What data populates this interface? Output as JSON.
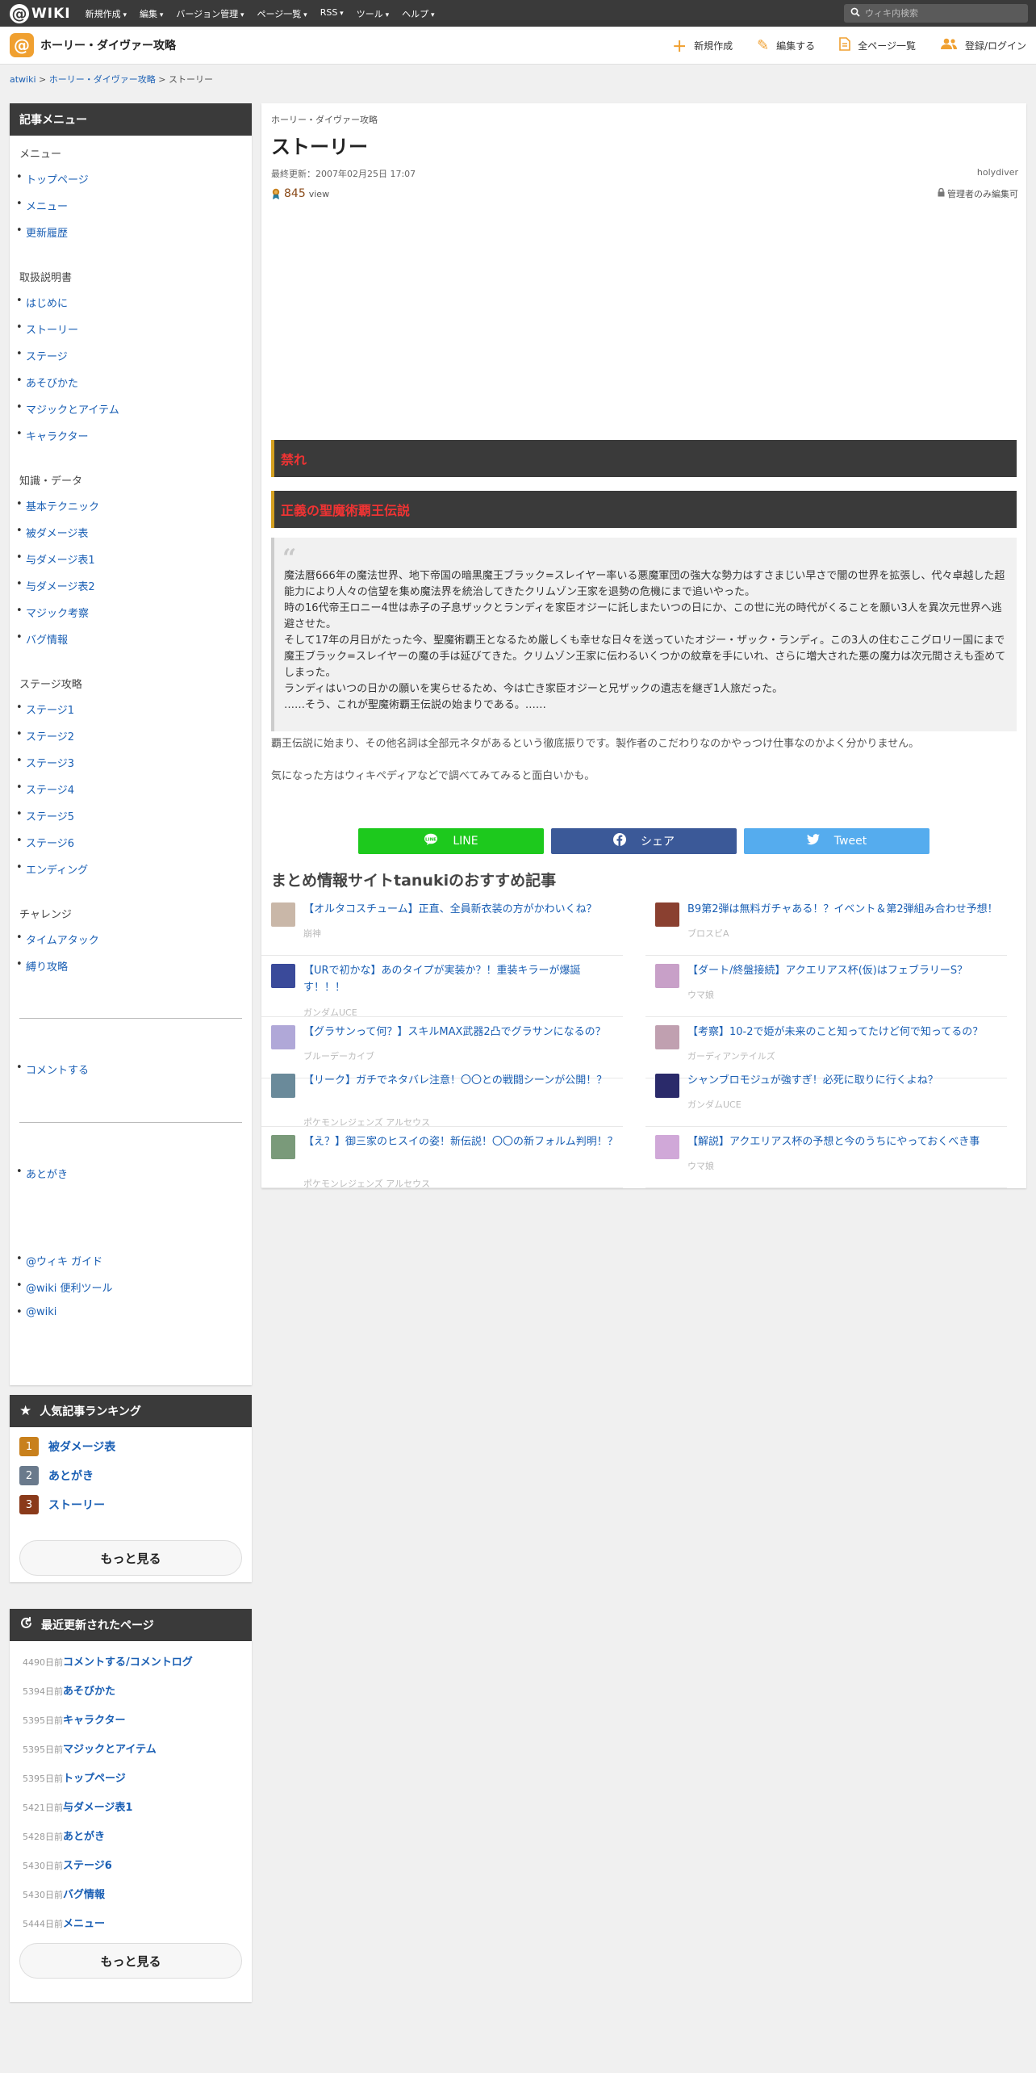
{
  "topbar": {
    "logo_mark": "@",
    "logo_text": "WIKI",
    "menus": [
      "新規作成",
      "編集",
      "バージョン管理",
      "ページ一覧",
      "RSS",
      "ツール",
      "ヘルプ"
    ],
    "search_placeholder": "ウィキ内検索"
  },
  "header": {
    "wiki_title": "ホーリー・ダイヴァー攻略",
    "actions": [
      "新規作成",
      "編集する",
      "全ページ一覧",
      "登録/ログイン"
    ]
  },
  "breadcrumb": {
    "root": "atwiki",
    "sep": ">",
    "wiki": "ホーリー・ダイヴァー攻略",
    "current": "ストーリー"
  },
  "sidebar": {
    "menu_title": "記事メニュー",
    "sections": [
      {
        "title": "メニュー",
        "items": [
          "トップページ",
          "メニュー",
          "更新履歴"
        ]
      },
      {
        "title": "取扱説明書",
        "items": [
          "はじめに",
          "ストーリー",
          "ステージ",
          "あそびかた",
          "マジックとアイテム",
          "キャラクター"
        ]
      },
      {
        "title": "知識・データ",
        "items": [
          "基本テクニック",
          "被ダメージ表",
          "与ダメージ表1",
          "与ダメージ表2",
          "マジック考察",
          "バグ情報"
        ]
      },
      {
        "title": "ステージ攻略",
        "items": [
          "ステージ1",
          "ステージ2",
          "ステージ3",
          "ステージ4",
          "ステージ5",
          "ステージ6",
          "エンディング"
        ]
      },
      {
        "title": "チャレンジ",
        "items": [
          "タイムアタック",
          "縛り攻略"
        ]
      }
    ],
    "comment_link": "コメントする",
    "afterword_link": "あとがき",
    "footer_links": [
      "@ウィキ ガイド",
      "@wiki 便利ツール",
      "@wiki"
    ]
  },
  "ranking": {
    "title": "人気記事ランキング",
    "items": [
      {
        "rank": "1",
        "label": "被ダメージ表"
      },
      {
        "rank": "2",
        "label": "あとがき"
      },
      {
        "rank": "3",
        "label": "ストーリー"
      }
    ],
    "more": "もっと見る",
    "colors": [
      "#c8801c",
      "#6a7a8c",
      "#8a3a1a"
    ]
  },
  "recent": {
    "title": "最近更新されたページ",
    "items": [
      {
        "days": "4490日前",
        "title": "コメントする/コメントログ"
      },
      {
        "days": "5394日前",
        "title": "あそびかた"
      },
      {
        "days": "5395日前",
        "title": "キャラクター"
      },
      {
        "days": "5395日前",
        "title": "マジックとアイテム"
      },
      {
        "days": "5395日前",
        "title": "トップページ"
      },
      {
        "days": "5421日前",
        "title": "与ダメージ表1"
      },
      {
        "days": "5428日前",
        "title": "あとがき"
      },
      {
        "days": "5430日前",
        "title": "ステージ6"
      },
      {
        "days": "5430日前",
        "title": "バグ情報"
      },
      {
        "days": "5444日前",
        "title": "メニュー"
      }
    ],
    "more": "もっと見る"
  },
  "article": {
    "wiki_name": "ホーリー・ダイヴァー攻略",
    "title": "ストーリー",
    "updated": "最終更新：2007年02月25日 17:07",
    "author": "holydiver",
    "views": "845",
    "views_unit": "view",
    "lock_note": "管理者のみ編集可",
    "banner1": "禁れ",
    "banner2": "正義の聖魔術覇王伝説",
    "quote_lines": [
      "魔法暦666年の魔法世界、地下帝国の暗黒魔王ブラック=スレイヤー率いる悪魔軍団の強大な勢力はすさまじい早さで闇の世界を拡張し、代々卓越した超能力により人々の信望を集め魔法界を統治してきたクリムゾン王家を退勢の危機にまで追いやった。",
      "時の16代帝王ロニー4世は赤子の子息ザックとランディを家臣オジーに託しまたいつの日にか、この世に光の時代がくることを願い3人を異次元世界へ逃避させた。",
      "そして17年の月日がたった今、聖魔術覇王となるため厳しくも幸せな日々を送っていたオジー・ザック・ランディ。この3人の住むここグロリー国にまで魔王ブラック=スレイヤーの魔の手は延びてきた。クリムゾン王家に伝わるいくつかの紋章を手にいれ、さらに増大された悪の魔力は次元間さえも歪めてしまった。",
      "ランディはいつの日かの願いを実らせるため、今は亡き家臣オジーと兄ザックの遺志を継ぎ1人旅だった。",
      "……そう、これが聖魔術覇王伝説の始まりである。……"
    ],
    "para1": "覇王伝説に始まり、その他名詞は全部元ネタがあるという徹底振りです。製作者のこだわりなのかやっつけ仕事なのかよく分かりません。",
    "para2": "気になった方はウィキペディアなどで調べてみてみると面白いかも。",
    "share": {
      "line": "LINE",
      "facebook": "シェア",
      "twitter": "Tweet"
    },
    "share_colors": {
      "line": "#1dc91d",
      "facebook": "#3b5998",
      "twitter": "#55acee"
    }
  },
  "recommend": {
    "title": "まとめ情報サイトtanukiのおすすめ記事",
    "items": [
      {
        "title": "【オルタコスチューム】正直、全員新衣装の方がかわいくね？",
        "source": "崩神"
      },
      {
        "title": "B9第2弾は無料ガチャある！？イベント＆第2弾組み合わせ予想！",
        "source": "ブロスビA"
      },
      {
        "title": "【URで初かな】あのタイプが実装か？！重装キラーが爆誕す！！！",
        "source": "ガンダムUCE"
      },
      {
        "title": "【ダート/終盤接続】アクエリアス杯(仮)はフェブラリーS？",
        "source": "ウマ娘"
      },
      {
        "title": "【グラサンって何？】スキルMAX武器2凸でグラサンになるの？",
        "source": "ブルーデーカイブ"
      },
      {
        "title": "【考察】10-2で姫が未来のこと知ってたけど何で知ってるの？",
        "source": "ガーディアンテイルズ"
      },
      {
        "title": "【リーク】ガチでネタバレ注意！〇〇との戦闘シーンが公開！？",
        "source": "ポケモンレジェンズ アルセウス"
      },
      {
        "title": "シャンブロモジュが強すぎ！必死に取りに行くよね？",
        "source": "ガンダムUCE"
      },
      {
        "title": "【え？】御三家のヒスイの姿！新伝説！〇〇の新フォルム判明！？",
        "source": "ポケモンレジェンズ アルセウス"
      },
      {
        "title": "【解説】アクエリアス杯の予想と今のうちにやっておくべき事",
        "source": "ウマ娘"
      }
    ],
    "thumb_colors": [
      "#c9b7a8",
      "#8a4030",
      "#3a4a9a",
      "#c8a0c8",
      "#b0a8d8",
      "#c0a0b0",
      "#6a8a9a",
      "#2a2a6a",
      "#7a9a7a",
      "#d0a8d8"
    ]
  }
}
